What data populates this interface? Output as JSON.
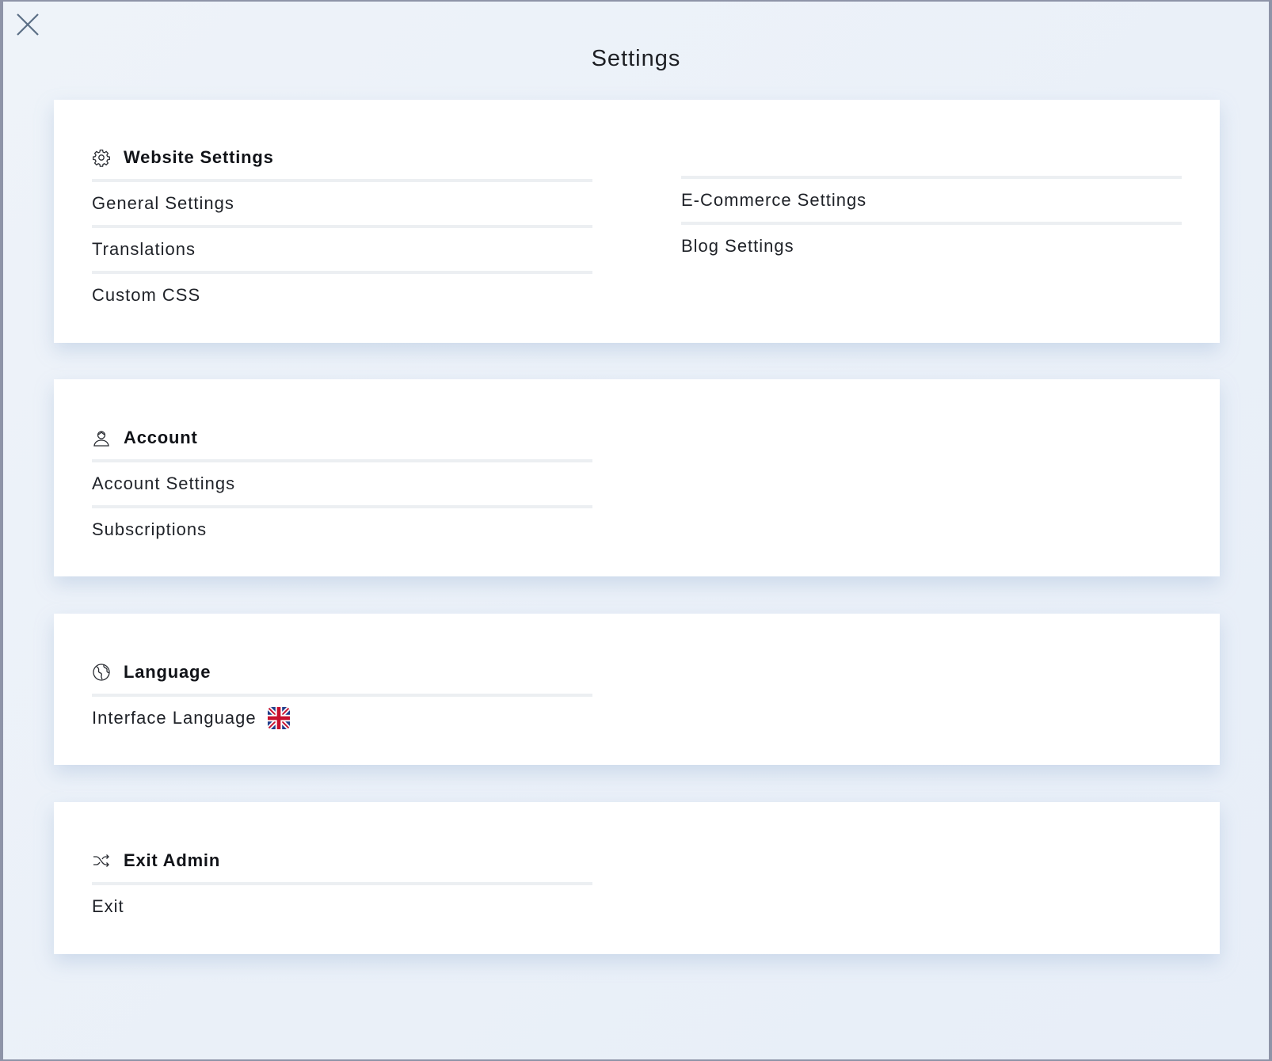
{
  "page": {
    "title": "Settings"
  },
  "website_settings": {
    "title": "Website Settings",
    "icon": "gear-icon",
    "left_items": [
      "General Settings",
      "Translations",
      "Custom CSS"
    ],
    "right_items": [
      "E-Commerce Settings",
      "Blog Settings"
    ]
  },
  "account": {
    "title": "Account",
    "icon": "user-icon",
    "items": [
      "Account Settings",
      "Subscriptions"
    ]
  },
  "language": {
    "title": "Language",
    "icon": "globe-icon",
    "items": [
      "Interface Language"
    ],
    "flag_icon": "uk-flag-icon"
  },
  "exit_admin": {
    "title": "Exit Admin",
    "icon": "shuffle-icon",
    "items": [
      "Exit"
    ]
  },
  "colors": {
    "background": "#e9eff8",
    "card": "#ffffff",
    "divider": "#eceff2",
    "text": "#1f2228",
    "close_icon": "#5b6f86"
  }
}
